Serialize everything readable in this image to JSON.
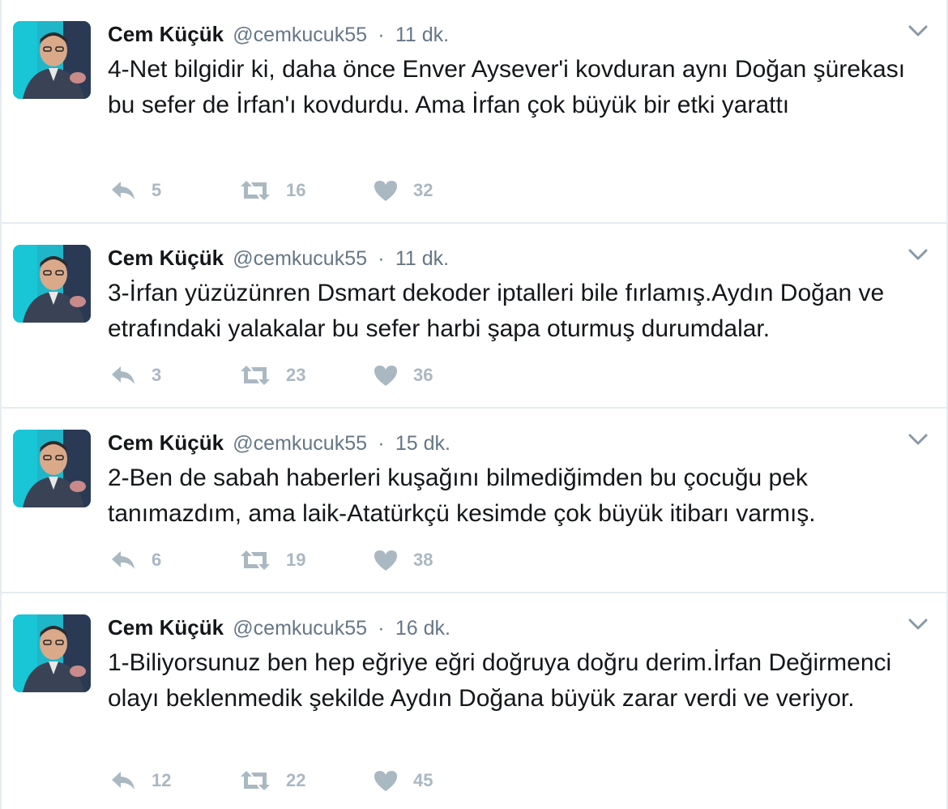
{
  "colors": {
    "text": "#14171a",
    "secondary": "#657786",
    "action_icon": "#aab8c2",
    "border": "#e6ecf0"
  },
  "tweets": [
    {
      "name": "Cem Küçük",
      "handle": "@cemkucuk55",
      "separator": "·",
      "time": "11 dk.",
      "text": "4-Net bilgidir ki, daha önce Enver Aysever'i kovduran aynı Doğan şürekası bu sefer de İrfan'ı kovdurdu. Ama İrfan çok büyük bir etki yarattı",
      "replies": "5",
      "retweets": "16",
      "likes": "32"
    },
    {
      "name": "Cem Küçük",
      "handle": "@cemkucuk55",
      "separator": "·",
      "time": "11 dk.",
      "text": "3-İrfan yüzüzünren Dsmart dekoder iptalleri bile fırlamış.Aydın Doğan ve etrafındaki yalakalar bu sefer harbi şapa oturmuş durumdalar.",
      "replies": "3",
      "retweets": "23",
      "likes": "36"
    },
    {
      "name": "Cem Küçük",
      "handle": "@cemkucuk55",
      "separator": "·",
      "time": "15 dk.",
      "text": "2-Ben de sabah haberleri kuşağını bilmediğimden bu çocuğu pek tanımazdım, ama laik-Atatürkçü kesimde çok büyük itibarı varmış.",
      "replies": "6",
      "retweets": "19",
      "likes": "38"
    },
    {
      "name": "Cem Küçük",
      "handle": "@cemkucuk55",
      "separator": "·",
      "time": "16 dk.",
      "text": "1-Biliyorsunuz ben hep eğriye eğri doğruya doğru derim.İrfan Değirmenci olayı beklenmedik şekilde Aydın Doğana büyük zarar verdi ve veriyor.",
      "replies": "12",
      "retweets": "22",
      "likes": "45"
    }
  ]
}
